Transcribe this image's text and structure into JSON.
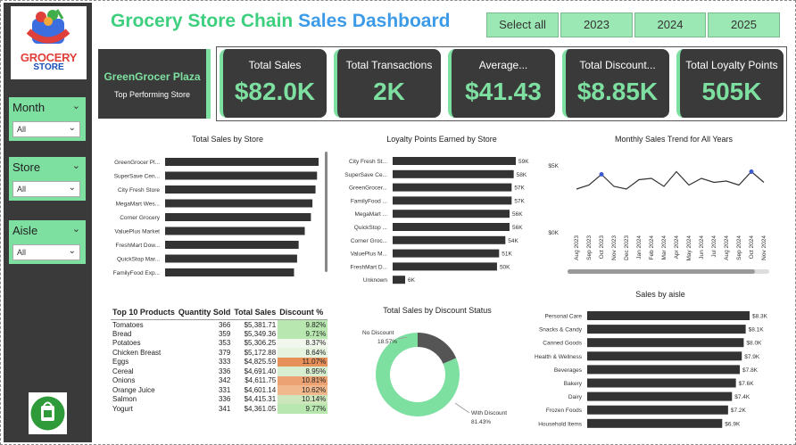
{
  "sidebar": {
    "logo": {
      "line1": "GROCERY",
      "line2": "STORE"
    },
    "filters": [
      {
        "label": "Month",
        "value": "All"
      },
      {
        "label": "Store",
        "value": "All"
      },
      {
        "label": "Aisle",
        "value": "All"
      }
    ]
  },
  "header": {
    "title_part1": "Grocery Store Chain",
    "title_part2": "Sales Dashboard",
    "year_buttons": [
      "Select all",
      "2023",
      "2024",
      "2025"
    ]
  },
  "top_store": {
    "name": "GreenGrocer Plaza",
    "subtitle": "Top Performing Store"
  },
  "kpis": [
    {
      "label": "Total Sales",
      "value": "$82.0K"
    },
    {
      "label": "Total Transactions",
      "value": "2K"
    },
    {
      "label": "Average...",
      "value": "$41.43"
    },
    {
      "label": "Total Discount...",
      "value": "$8.85K"
    },
    {
      "label": "Total Loyalty Points",
      "value": "505K"
    }
  ],
  "colors": {
    "accent_green": "#7ee0a0",
    "dark_panel": "#3a3a3a",
    "bar": "#333333",
    "title_green": "#3ecf7e",
    "title_blue": "#3c9be8"
  },
  "chart_data": [
    {
      "type": "bar",
      "title": "Total Sales by Store",
      "orientation": "horizontal",
      "categories": [
        "GreenGrocer Pl...",
        "SuperSave Cen...",
        "City Fresh Store",
        "MegaMart Wes...",
        "Corner Grocery",
        "ValuePlus Market",
        "FreshMart Dow...",
        "QuickStop Mar...",
        "FamilyFood Exp..."
      ],
      "values": [
        10.0,
        9.9,
        9.8,
        9.6,
        9.5,
        9.1,
        8.7,
        8.6,
        8.4
      ]
    },
    {
      "type": "bar",
      "title": "Loyalty Points Earned by Store",
      "orientation": "horizontal",
      "categories": [
        "City Fresh St...",
        "SuperSave Ce...",
        "GreenGrocer...",
        "FamilyFood ...",
        "MegaMart ...",
        "QuickStop ...",
        "Corner Groc...",
        "ValuePlus M...",
        "FreshMart D...",
        "Unknown"
      ],
      "values": [
        59,
        58,
        57,
        57,
        56,
        56,
        54,
        51,
        50,
        6
      ],
      "labels": [
        "59K",
        "58K",
        "57K",
        "57K",
        "56K",
        "56K",
        "54K",
        "51K",
        "50K",
        "6K"
      ]
    },
    {
      "type": "line",
      "title": "Monthly Sales Trend for All Years",
      "x": [
        "Aug 2023",
        "Sep 2023",
        "Oct 2023",
        "Nov 2023",
        "Dec 2023",
        "Jan 2024",
        "Feb 2024",
        "Mar 2024",
        "Apr 2024",
        "May 2024",
        "Jun 2024",
        "Jul 2024",
        "Aug 2024",
        "Sep 2024",
        "Oct 2024",
        "Nov 2024"
      ],
      "values": [
        3.2,
        3.5,
        4.3,
        3.4,
        3.2,
        3.9,
        4.0,
        3.4,
        4.5,
        3.5,
        4.0,
        3.7,
        3.8,
        3.5,
        4.5,
        3.7
      ],
      "yticks": [
        "$5K",
        "$0K"
      ],
      "ylim": [
        0,
        5
      ],
      "highlighted": [
        "Oct 2023",
        "Oct 2024"
      ]
    },
    {
      "type": "table",
      "title": "Top 10 Products",
      "columns": [
        "Top 10 Products",
        "Quantity Sold",
        "Total Sales",
        "Discount %"
      ],
      "rows": [
        [
          "Tomatoes",
          "366",
          "$5,381.71",
          "9.82%"
        ],
        [
          "Bread",
          "359",
          "$5,349.36",
          "9.71%"
        ],
        [
          "Potatoes",
          "353",
          "$5,306.25",
          "8.37%"
        ],
        [
          "Chicken Breast",
          "379",
          "$5,172.88",
          "8.64%"
        ],
        [
          "Eggs",
          "333",
          "$4,825.59",
          "11.07%"
        ],
        [
          "Cereal",
          "336",
          "$4,691.40",
          "8.95%"
        ],
        [
          "Onions",
          "342",
          "$4,611.75",
          "10.81%"
        ],
        [
          "Orange Juice",
          "331",
          "$4,601.14",
          "10.62%"
        ],
        [
          "Salmon",
          "336",
          "$4,415.31",
          "10.14%"
        ],
        [
          "Yogurt",
          "341",
          "$4,361.05",
          "9.77%"
        ]
      ],
      "discount_colors": [
        "#b8e8b0",
        "#b8e8b0",
        "#f2f7ee",
        "#e6f3df",
        "#e8905a",
        "#d8eed0",
        "#eca272",
        "#f0b88c",
        "#cde6bc",
        "#b8e8b0"
      ]
    },
    {
      "type": "pie",
      "title": "Total Sales by Discount Status",
      "donut": true,
      "categories": [
        "No Discount",
        "With Discount"
      ],
      "values": [
        18.57,
        81.43
      ],
      "labels": [
        "18.57%",
        "81.43%"
      ],
      "colors": [
        "#555555",
        "#7ee0a0"
      ]
    },
    {
      "type": "bar",
      "title": "Sales by aisle",
      "orientation": "horizontal",
      "categories": [
        "Personal Care",
        "Snacks & Candy",
        "Canned Goods",
        "Health & Wellness",
        "Beverages",
        "Bakery",
        "Dairy",
        "Frozen Foods",
        "Household Items"
      ],
      "values": [
        8.3,
        8.1,
        8.0,
        7.9,
        7.8,
        7.6,
        7.4,
        7.2,
        6.9
      ],
      "labels": [
        "$8.3K",
        "$8.1K",
        "$8.0K",
        "$7.9K",
        "$7.8K",
        "$7.6K",
        "$7.4K",
        "$7.2K",
        "$6.9K"
      ]
    }
  ]
}
